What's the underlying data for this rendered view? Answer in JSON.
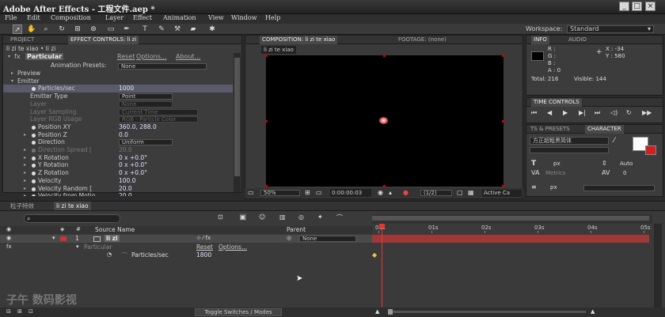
{
  "app": {
    "title": "Adobe After Effects - 工程文件.aep *",
    "min": "_",
    "max": "□",
    "close": "×"
  },
  "menu": [
    "File",
    "Edit",
    "Composition",
    "Layer",
    "Effect",
    "Animation",
    "View",
    "Window",
    "Help"
  ],
  "workspace": {
    "label": "Workspace:",
    "value": "Standard"
  },
  "effect_controls": {
    "tab_project": "PROJECT",
    "tab_effect": "EFFECT CONTROLS: li zi",
    "breadcrumb": "li zi te xiao • li zi",
    "effect_name": "Particular",
    "reset": "Reset",
    "options": "Options...",
    "about": "About...",
    "presets_label": "Animation Presets:",
    "presets_value": "None",
    "rows": [
      {
        "label": "Preview",
        "indent": 1,
        "tri": "▸",
        "value": ""
      },
      {
        "label": "Emitter",
        "indent": 1,
        "tri": "▾",
        "value": ""
      },
      {
        "label": "Particles/sec",
        "indent": 2,
        "icon": true,
        "value": "1000",
        "selected": true
      },
      {
        "label": "Emitter Type",
        "indent": 2,
        "value": "Point",
        "dropdown": true
      },
      {
        "label": "Layer",
        "indent": 2,
        "value": "None",
        "dropdown": true,
        "dim": true
      },
      {
        "label": "Layer Sampling",
        "indent": 2,
        "value": "Current Time",
        "dropdown": true,
        "dim": true
      },
      {
        "label": "Layer RGB Usage",
        "indent": 2,
        "value": "RGB - Particle Color",
        "dropdown": true,
        "dim": true
      },
      {
        "label": "Position XY",
        "indent": 2,
        "icon": true,
        "value": "360.0, 288.0"
      },
      {
        "label": "Position Z",
        "indent": 2,
        "tri": "▸",
        "icon": true,
        "value": "0.0"
      },
      {
        "label": "Direction",
        "indent": 2,
        "icon": true,
        "value": "Uniform",
        "dropdown": true
      },
      {
        "label": "Direction Spread [",
        "indent": 2,
        "tri": "▸",
        "icon": true,
        "value": "20.0",
        "dim": true
      },
      {
        "label": "X Rotation",
        "indent": 2,
        "tri": "▸",
        "icon": true,
        "value": "0 x +0.0°"
      },
      {
        "label": "Y Rotation",
        "indent": 2,
        "tri": "▸",
        "icon": true,
        "value": "0 x +0.0°"
      },
      {
        "label": "Z Rotation",
        "indent": 2,
        "tri": "▸",
        "icon": true,
        "value": "0 x +0.0°"
      },
      {
        "label": "Velocity",
        "indent": 2,
        "tri": "▸",
        "icon": true,
        "value": "100.0"
      },
      {
        "label": "Velocity Random [",
        "indent": 2,
        "tri": "▸",
        "icon": true,
        "value": "20.0"
      },
      {
        "label": "Velocity from Motio",
        "indent": 2,
        "tri": "▸",
        "icon": true,
        "value": "20.0"
      }
    ]
  },
  "composition": {
    "tab": "COMPOSITION: li zi te xiao",
    "tab2": "FOOTAGE: (none)",
    "chip": "li zi te xiao",
    "zoom": "50%",
    "timecode": "0:00:00:03",
    "resolution": "(1/2)",
    "camera": "Active Ca"
  },
  "info": {
    "tab": "INFO",
    "tab2": "AUDIO",
    "r": "R :",
    "g": "G :",
    "b": "B :",
    "a": "A : 0",
    "x": "X : -34",
    "y": "Y : 580",
    "total": "Total: 216",
    "visible": "Visible: 144"
  },
  "time_controls": {
    "tab": "TIME CONTROLS"
  },
  "character": {
    "tab_presets": "TS & PRESETS",
    "tab_char": "CHARACTER",
    "font": "方正超粗黑简体",
    "size_unit": "px",
    "leading": "Auto",
    "metrics": "Metrics",
    "tracking": "0",
    "stroke_unit": "px"
  },
  "timeline": {
    "tab1": "粒子特效",
    "tab2": "li zi te xiao",
    "col_source": "Source Name",
    "col_parent": "Parent",
    "layer_num": "1",
    "layer_name": "li zi",
    "parent_val": "None",
    "effect_row": "Particular",
    "reset": "Reset",
    "options": "Options...",
    "prop_name": "Particles/sec",
    "prop_val": "1800",
    "ticks": [
      "00s",
      "01s",
      "02s",
      "03s",
      "04s",
      "05s"
    ],
    "toggle": "Toggle Switches / Modes",
    "watermark": "子午 数码影视"
  },
  "colors": {
    "bg": "#2b2b2b",
    "panel": "#3c3c3c",
    "layerbar": "#a03838",
    "accent": "#e06060"
  }
}
